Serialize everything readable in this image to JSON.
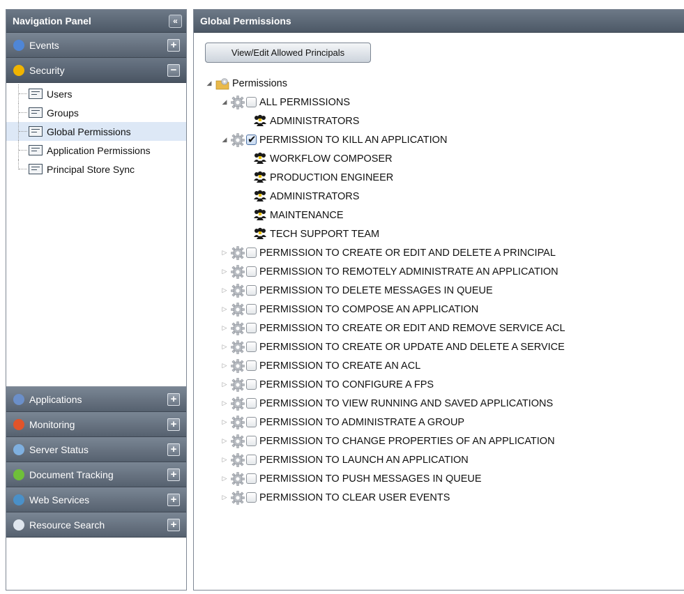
{
  "nav": {
    "title": "Navigation Panel",
    "collapse_glyph": "«",
    "sections_top": [
      {
        "label": "Events",
        "icon": "info-icon",
        "toggle": "+",
        "color": "#4f86d6"
      },
      {
        "label": "Security",
        "icon": "lock-icon",
        "toggle": "−",
        "color": "#f0b400"
      }
    ],
    "security_items": [
      {
        "label": "Users"
      },
      {
        "label": "Groups"
      },
      {
        "label": "Global Permissions",
        "selected": true
      },
      {
        "label": "Application Permissions"
      },
      {
        "label": "Principal Store Sync"
      }
    ],
    "sections_bottom": [
      {
        "label": "Applications",
        "icon": "applications-icon",
        "toggle": "+",
        "color": "#6b8fc9"
      },
      {
        "label": "Monitoring",
        "icon": "monitoring-icon",
        "toggle": "+",
        "color": "#e0542a"
      },
      {
        "label": "Server Status",
        "icon": "server-status-icon",
        "toggle": "+",
        "color": "#7fb0e0"
      },
      {
        "label": "Document Tracking",
        "icon": "document-tracking-icon",
        "toggle": "+",
        "color": "#6fbf3a"
      },
      {
        "label": "Web Services",
        "icon": "web-services-icon",
        "toggle": "+",
        "color": "#4a90c8"
      },
      {
        "label": "Resource Search",
        "icon": "search-icon",
        "toggle": "+",
        "color": "#dfe6ee"
      }
    ]
  },
  "main": {
    "title": "Global Permissions",
    "view_button": "View/Edit Allowed Principals",
    "tree_root": "Permissions",
    "permissions": [
      {
        "label": "ALL PERMISSIONS",
        "expanded": true,
        "checked": false,
        "principals": [
          "ADMINISTRATORS"
        ]
      },
      {
        "label": "PERMISSION TO KILL AN APPLICATION",
        "expanded": true,
        "checked": true,
        "principals": [
          "WORKFLOW COMPOSER",
          "PRODUCTION ENGINEER",
          "ADMINISTRATORS",
          "MAINTENANCE",
          "TECH SUPPORT TEAM"
        ]
      },
      {
        "label": "PERMISSION TO CREATE OR EDIT AND DELETE A PRINCIPAL",
        "expanded": false,
        "checked": false
      },
      {
        "label": "PERMISSION TO REMOTELY ADMINISTRATE AN APPLICATION",
        "expanded": false,
        "checked": false
      },
      {
        "label": "PERMISSION TO DELETE MESSAGES IN QUEUE",
        "expanded": false,
        "checked": false
      },
      {
        "label": "PERMISSION TO COMPOSE AN APPLICATION",
        "expanded": false,
        "checked": false
      },
      {
        "label": "PERMISSION TO CREATE OR EDIT AND REMOVE SERVICE ACL",
        "expanded": false,
        "checked": false
      },
      {
        "label": "PERMISSION TO CREATE OR UPDATE AND DELETE A SERVICE",
        "expanded": false,
        "checked": false
      },
      {
        "label": "PERMISSION TO CREATE AN ACL",
        "expanded": false,
        "checked": false
      },
      {
        "label": "PERMISSION TO CONFIGURE A FPS",
        "expanded": false,
        "checked": false
      },
      {
        "label": "PERMISSION TO VIEW RUNNING AND SAVED APPLICATIONS",
        "expanded": false,
        "checked": false
      },
      {
        "label": "PERMISSION TO ADMINISTRATE A GROUP",
        "expanded": false,
        "checked": false
      },
      {
        "label": "PERMISSION TO CHANGE PROPERTIES OF AN APPLICATION",
        "expanded": false,
        "checked": false
      },
      {
        "label": "PERMISSION TO LAUNCH AN APPLICATION",
        "expanded": false,
        "checked": false
      },
      {
        "label": "PERMISSION TO PUSH MESSAGES IN QUEUE",
        "expanded": false,
        "checked": false
      },
      {
        "label": "PERMISSION TO CLEAR USER EVENTS",
        "expanded": false,
        "checked": false
      }
    ]
  }
}
